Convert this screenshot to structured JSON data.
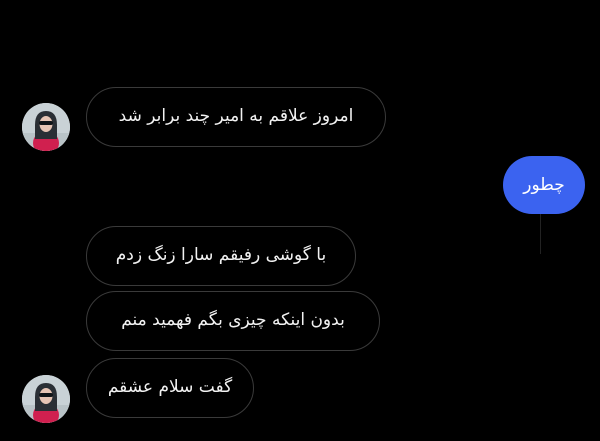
{
  "colors": {
    "background": "#000000",
    "incoming_bubble_border": "#3a3a3a",
    "incoming_text": "#f2f2f2",
    "outgoing_bubble": "#3b63f0",
    "outgoing_text": "#ffffff"
  },
  "messages": [
    {
      "direction": "incoming",
      "text": "امروز علاقم به امیر چند برابر شد",
      "avatar_icon": "contact-avatar-icon"
    },
    {
      "direction": "outgoing",
      "text": "چطور"
    },
    {
      "direction": "incoming",
      "text": "با گوشی رفیقم سارا زنگ زدم"
    },
    {
      "direction": "incoming",
      "text": "بدون اینکه چیزی بگم فهمید منم"
    },
    {
      "direction": "incoming",
      "text": "گفت سلام عشقم",
      "avatar_icon": "contact-avatar-icon"
    }
  ]
}
